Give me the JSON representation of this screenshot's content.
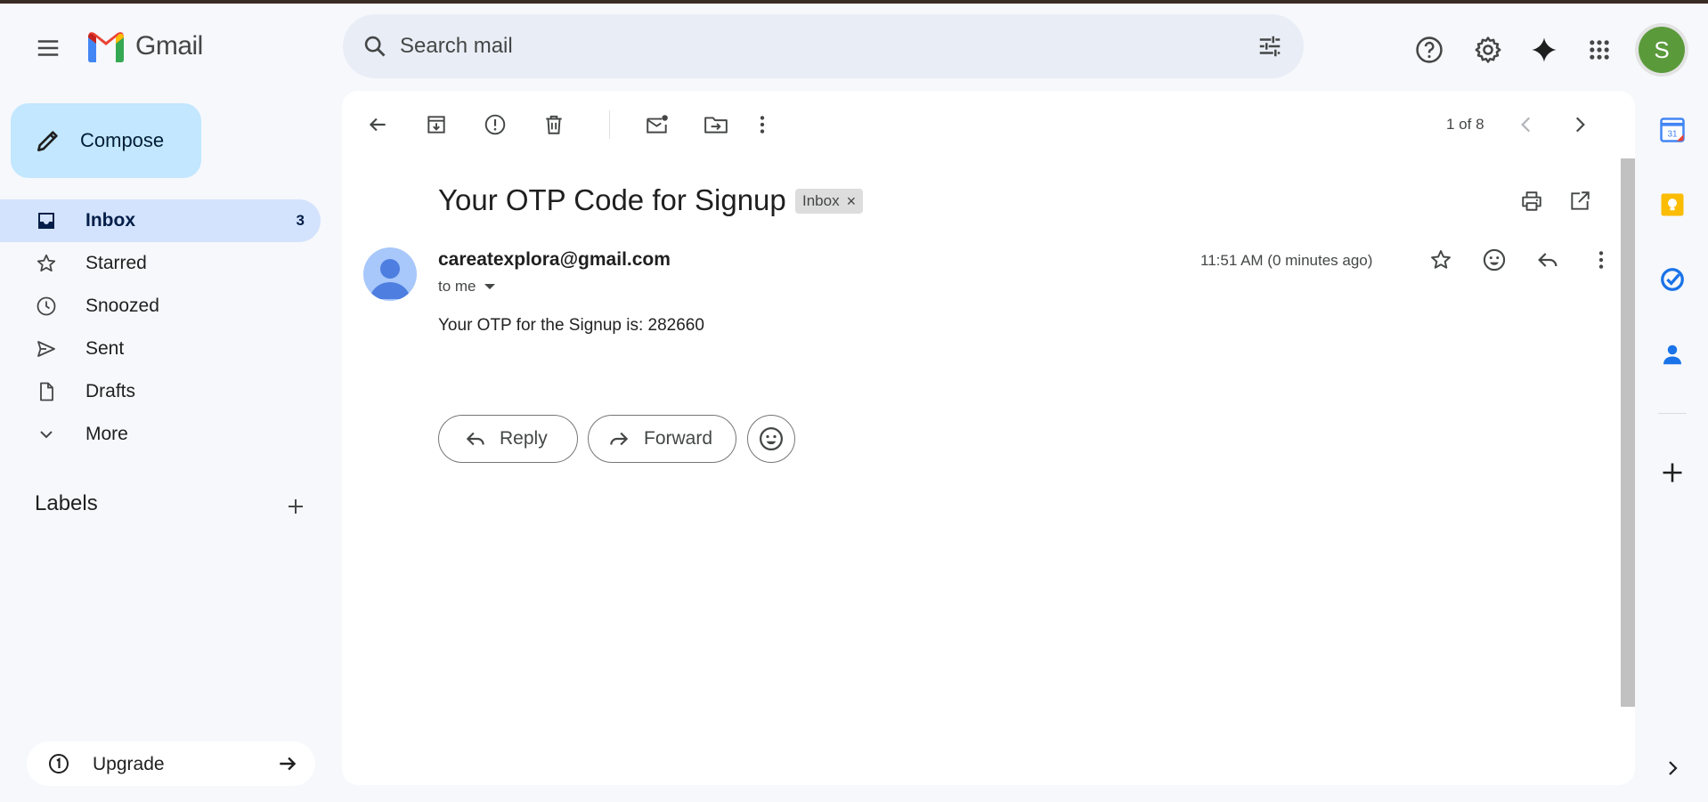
{
  "header": {
    "app_name": "Gmail",
    "search_placeholder": "Search mail",
    "avatar_letter": "S"
  },
  "sidebar": {
    "compose_label": "Compose",
    "items": [
      {
        "label": "Inbox",
        "count": "3",
        "icon": "inbox-icon"
      },
      {
        "label": "Starred",
        "icon": "star-icon"
      },
      {
        "label": "Snoozed",
        "icon": "clock-icon"
      },
      {
        "label": "Sent",
        "icon": "send-icon"
      },
      {
        "label": "Drafts",
        "icon": "draft-icon"
      },
      {
        "label": "More",
        "icon": "chevron-down-icon"
      }
    ],
    "labels_title": "Labels",
    "upgrade_label": "Upgrade"
  },
  "toolbar": {
    "counter": "1 of 8"
  },
  "email": {
    "subject": "Your OTP Code for Signup",
    "label_chip": "Inbox",
    "sender": "careatexplora@gmail.com",
    "recipient": "to me",
    "time": "11:51 AM (0 minutes ago)",
    "body": "Your OTP for the Signup is: 282660"
  },
  "actions": {
    "reply_label": "Reply",
    "forward_label": "Forward"
  },
  "colors": {
    "background": "#f6f8fc",
    "compose_bg": "#c2e7ff",
    "active_nav": "#d3e3fd",
    "avatar_green": "#5b9a3b"
  }
}
